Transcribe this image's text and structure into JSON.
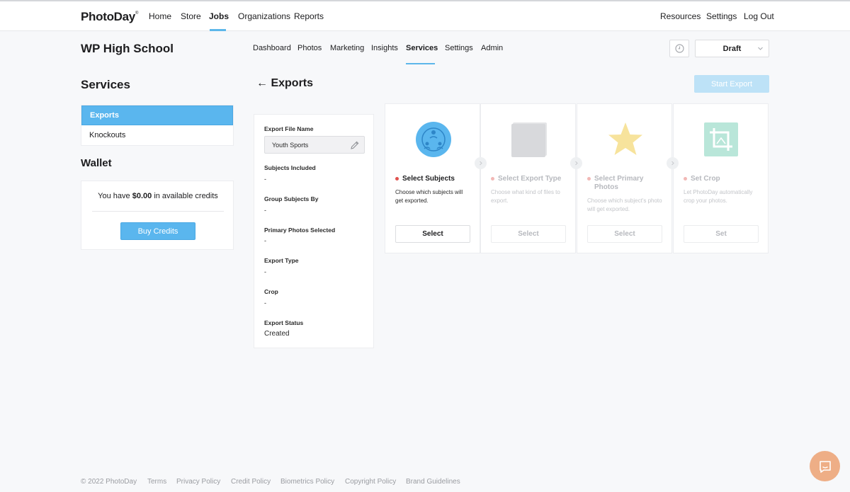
{
  "brand": {
    "logo": "PhotoDay",
    "trademark": "®",
    "accent": "#5ab6ee"
  },
  "topnav": {
    "left": [
      "Home",
      "Store",
      "Jobs",
      "Organizations",
      "Reports"
    ],
    "active": "Jobs",
    "right": [
      "Resources",
      "Settings",
      "Log Out"
    ]
  },
  "job": {
    "title": "WP High School",
    "tabs": [
      "Dashboard",
      "Photos",
      "Marketing",
      "Insights",
      "Services",
      "Settings",
      "Admin"
    ],
    "active_tab": "Services",
    "status": "Draft",
    "history_icon": "clock-icon"
  },
  "sidebar": {
    "heading": "Services",
    "items": [
      "Exports",
      "Knockouts"
    ],
    "active": "Exports"
  },
  "wallet": {
    "heading": "Wallet",
    "text_prefix": "You have",
    "amount": "$0.00",
    "text_suffix": "in available credits",
    "button": "Buy Credits"
  },
  "exports": {
    "back_arrow": "←",
    "title": "Exports",
    "start_button": "Start Export",
    "info": {
      "file_name_label": "Export File Name",
      "file_name_value": "Youth Sports",
      "fields": [
        {
          "label": "Subjects Included",
          "value": "-"
        },
        {
          "label": "Group Subjects By",
          "value": "-"
        },
        {
          "label": "Primary Photos Selected",
          "value": "-"
        },
        {
          "label": "Export Type",
          "value": "-"
        },
        {
          "label": "Crop",
          "value": "-"
        },
        {
          "label": "Export Status",
          "value": "Created"
        }
      ]
    },
    "steps": [
      {
        "title": "Select Subjects",
        "desc": "Choose which subjects will get exported.",
        "button": "Select",
        "icon": "subjects-icon",
        "dot_color": "#e0524f",
        "active": true
      },
      {
        "title": "Select Export Type",
        "desc": "Choose what kind of files to export.",
        "button": "Select",
        "icon": "folder-icon",
        "dot_color": "#f2b8b6",
        "active": false
      },
      {
        "title": "Select Primary Photos",
        "desc": "Choose which subject's photo will get exported.",
        "button": "Select",
        "icon": "star-icon",
        "dot_color": "#f2b8b6",
        "active": false
      },
      {
        "title": "Set Crop",
        "desc": "Let PhotoDay automatically crop your photos.",
        "button": "Set",
        "icon": "crop-icon",
        "dot_color": "#f2b8b6",
        "active": false
      }
    ]
  },
  "footer": {
    "copyright": "© 2022 PhotoDay",
    "links": [
      "Terms",
      "Privacy Policy",
      "Credit Policy",
      "Biometrics Policy",
      "Copyright Policy",
      "Brand Guidelines"
    ]
  },
  "chat": {
    "icon": "chat-icon",
    "color": "#eeae86"
  }
}
